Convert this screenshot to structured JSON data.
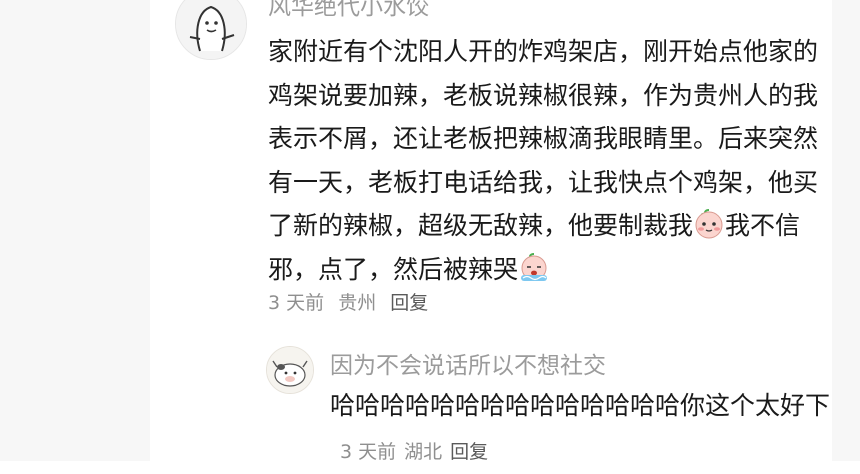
{
  "comment": {
    "username": "风华绝代小水饺",
    "text_segments": [
      {
        "type": "text",
        "value": "家附近有个沈阳人开的炸鸡架店，刚开始点他家的鸡架说要加辣，老板说辣椒很辣，作为贵州人的我表示不屑，还让老板把辣椒滴我眼睛里。后来突然有一天，老板打电话给我，让我快点个鸡架，他买了新的辣椒，超级无敌辣，他要制裁我"
      },
      {
        "type": "emoji",
        "name": "peach-face-emoji"
      },
      {
        "type": "text",
        "value": "我不信邪，点了，然后被辣哭"
      },
      {
        "type": "emoji",
        "name": "crying-face-emoji"
      }
    ],
    "time": "3 天前",
    "location": "贵州",
    "reply_label": "回复"
  },
  "reply": {
    "username": "因为不会说话所以不想社交",
    "text": "哈哈哈哈哈哈哈哈哈哈哈哈哈哈你这个太好下",
    "time": "3 天前",
    "location": "湖北",
    "reply_label": "回复"
  }
}
